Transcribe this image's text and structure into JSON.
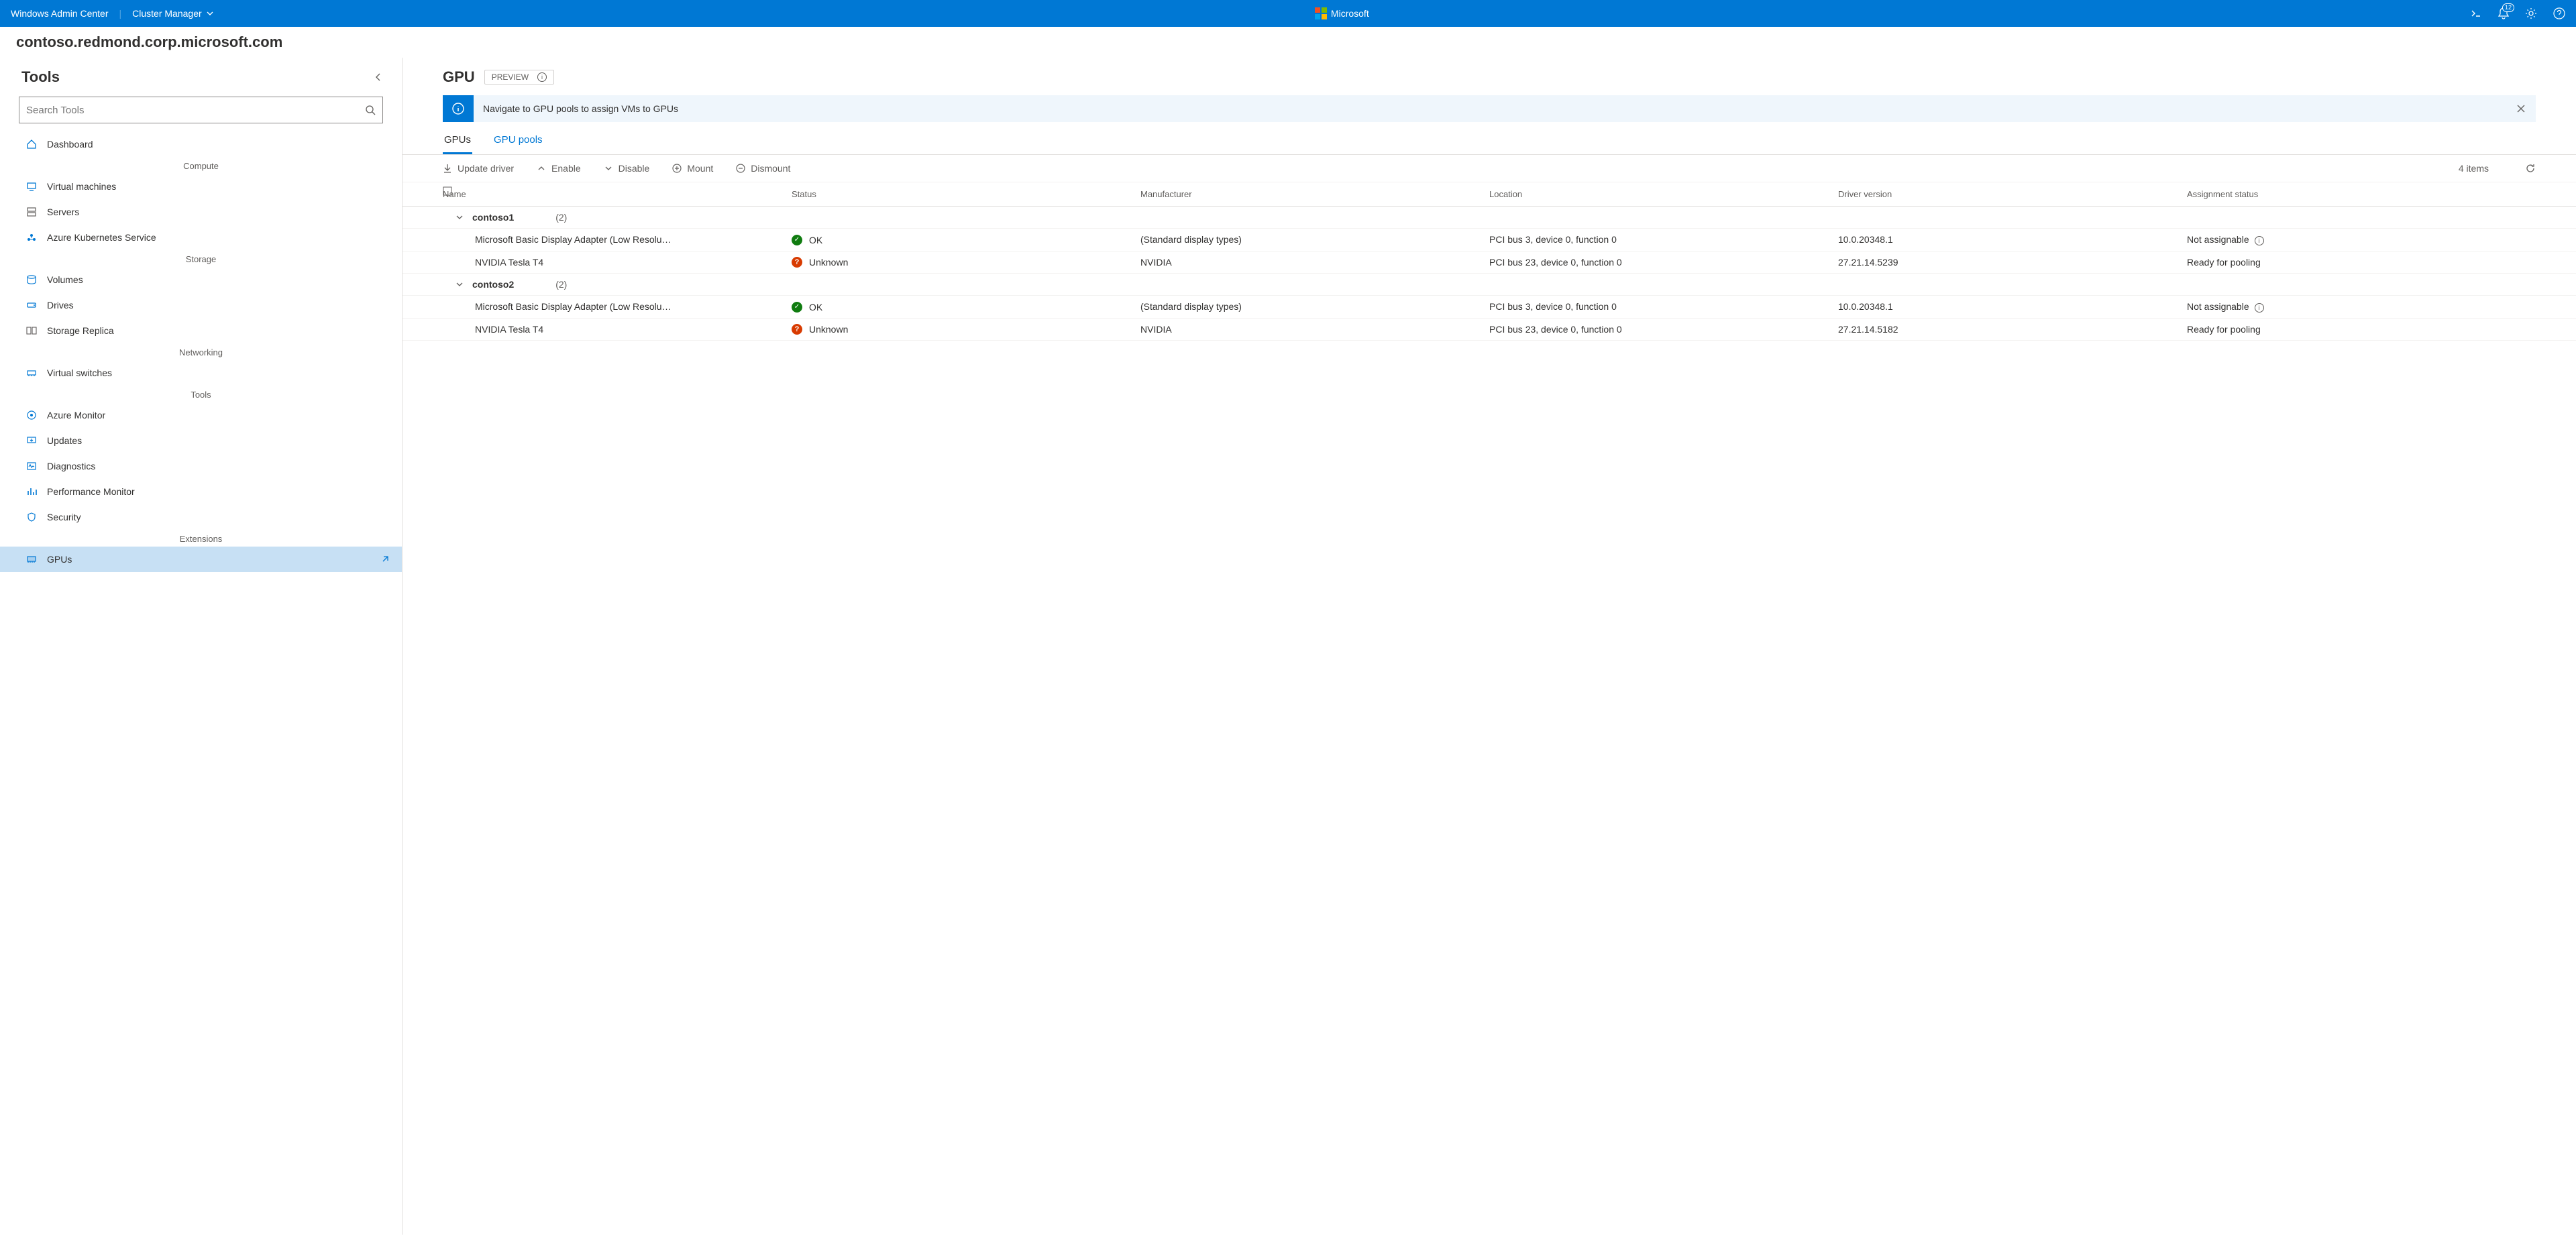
{
  "appbar": {
    "product": "Windows Admin Center",
    "context": "Cluster Manager",
    "brand": "Microsoft",
    "notification_count": "12"
  },
  "breadcrumb": "contoso.redmond.corp.microsoft.com",
  "tools": {
    "title": "Tools",
    "search_placeholder": "Search Tools",
    "groups": [
      {
        "label": "",
        "items": [
          {
            "id": "dashboard",
            "label": "Dashboard"
          }
        ]
      },
      {
        "label": "Compute",
        "items": [
          {
            "id": "vms",
            "label": "Virtual machines"
          },
          {
            "id": "servers",
            "label": "Servers"
          },
          {
            "id": "aks",
            "label": "Azure Kubernetes Service"
          }
        ]
      },
      {
        "label": "Storage",
        "items": [
          {
            "id": "volumes",
            "label": "Volumes"
          },
          {
            "id": "drives",
            "label": "Drives"
          },
          {
            "id": "storage-replica",
            "label": "Storage Replica"
          }
        ]
      },
      {
        "label": "Networking",
        "items": [
          {
            "id": "vswitches",
            "label": "Virtual switches"
          }
        ]
      },
      {
        "label": "Tools",
        "items": [
          {
            "id": "azure-monitor",
            "label": "Azure Monitor"
          },
          {
            "id": "updates",
            "label": "Updates"
          },
          {
            "id": "diagnostics",
            "label": "Diagnostics"
          },
          {
            "id": "perfmon",
            "label": "Performance Monitor"
          },
          {
            "id": "security",
            "label": "Security"
          }
        ]
      },
      {
        "label": "Extensions",
        "items": [
          {
            "id": "gpus",
            "label": "GPUs",
            "selected": true,
            "extension": true
          }
        ]
      }
    ]
  },
  "page": {
    "title": "GPU",
    "preview_label": "PREVIEW",
    "banner": "Navigate to GPU pools to assign VMs to GPUs",
    "tabs": [
      {
        "id": "gpus",
        "label": "GPUs",
        "active": true
      },
      {
        "id": "gpu-pools",
        "label": "GPU pools"
      }
    ],
    "toolbar": [
      {
        "id": "update-driver",
        "label": "Update driver"
      },
      {
        "id": "enable",
        "label": "Enable"
      },
      {
        "id": "disable",
        "label": "Disable"
      },
      {
        "id": "mount",
        "label": "Mount"
      },
      {
        "id": "dismount",
        "label": "Dismount"
      }
    ],
    "item_count": "4 items",
    "columns": [
      "Name",
      "Status",
      "Manufacturer",
      "Location",
      "Driver version",
      "Assignment status"
    ],
    "groups": [
      {
        "name": "contoso1",
        "count": "(2)",
        "rows": [
          {
            "name": "Microsoft Basic Display Adapter (Low Resolu…",
            "status": "OK",
            "status_kind": "ok",
            "manufacturer": "(Standard display types)",
            "location": "PCI bus 3, device 0, function 0",
            "driver": "10.0.20348.1",
            "assignment": "Not assignable",
            "info": true
          },
          {
            "name": "NVIDIA Tesla T4",
            "status": "Unknown",
            "status_kind": "warn",
            "manufacturer": "NVIDIA",
            "location": "PCI bus 23, device 0, function 0",
            "driver": "27.21.14.5239",
            "assignment": "Ready for pooling"
          }
        ]
      },
      {
        "name": "contoso2",
        "count": "(2)",
        "rows": [
          {
            "name": "Microsoft Basic Display Adapter (Low Resolu…",
            "status": "OK",
            "status_kind": "ok",
            "manufacturer": "(Standard display types)",
            "location": "PCI bus 3, device 0, function 0",
            "driver": "10.0.20348.1",
            "assignment": "Not assignable",
            "info": true
          },
          {
            "name": "NVIDIA Tesla T4",
            "status": "Unknown",
            "status_kind": "warn",
            "manufacturer": "NVIDIA",
            "location": "PCI bus 23, device 0, function 0",
            "driver": "27.21.14.5182",
            "assignment": "Ready for pooling"
          }
        ]
      }
    ]
  }
}
